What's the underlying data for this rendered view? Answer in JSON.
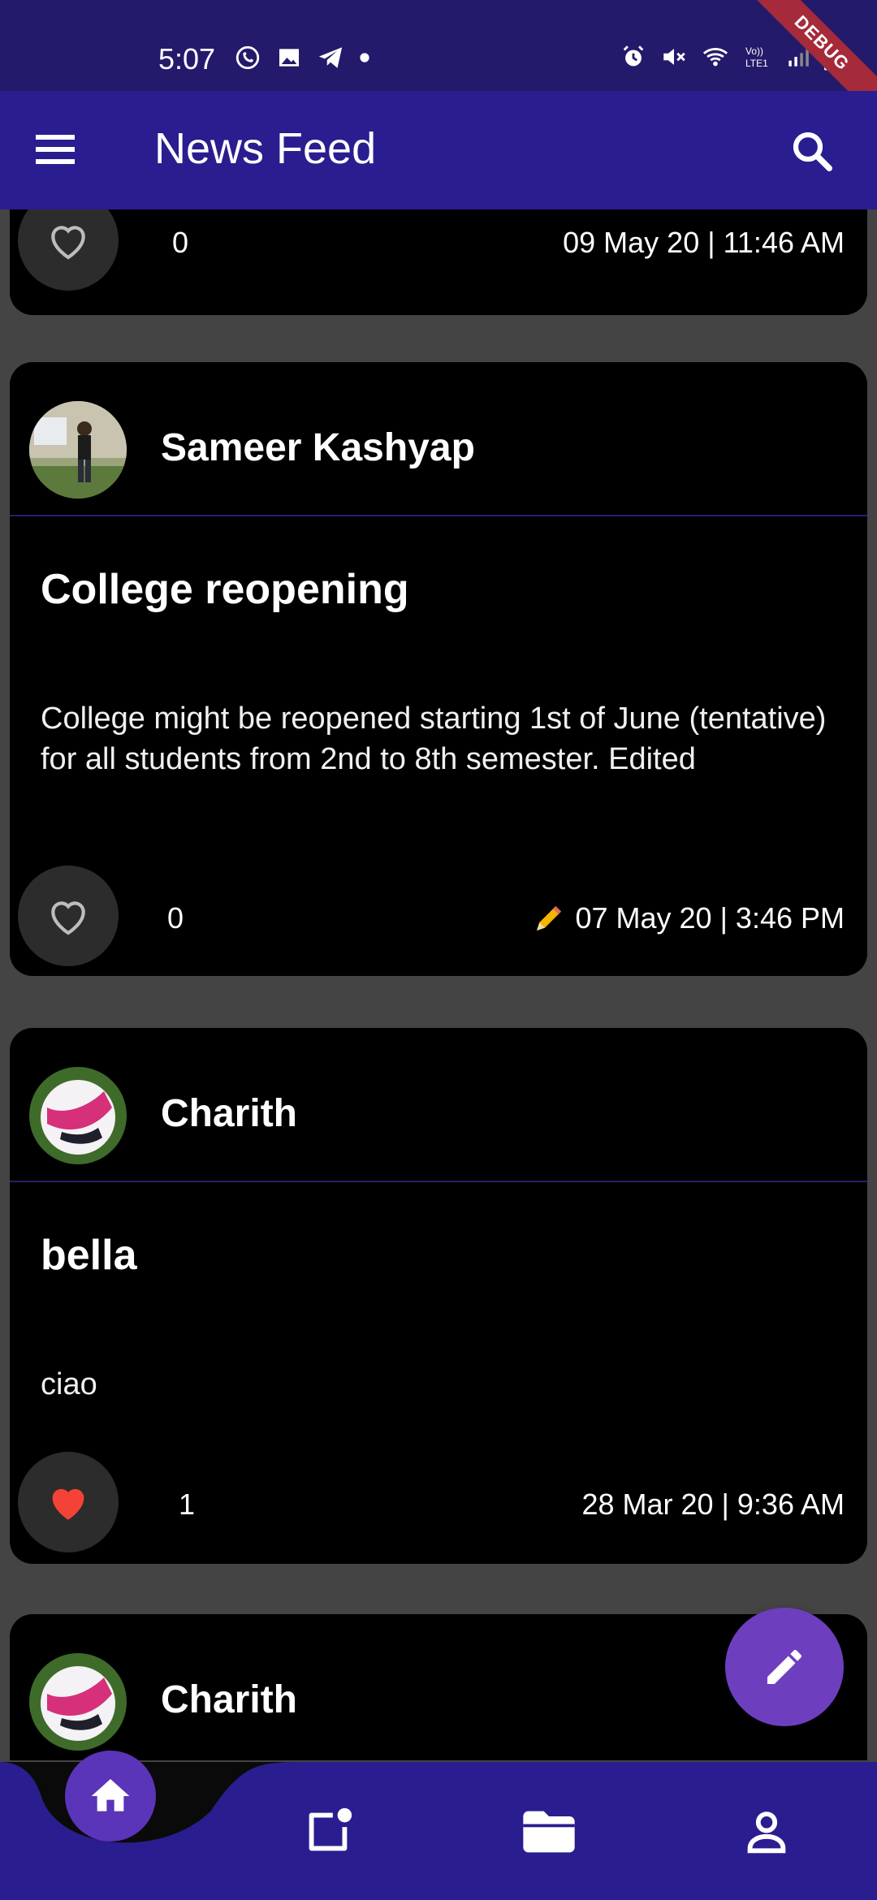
{
  "status_bar": {
    "time": "5:07",
    "debug_label": "DEBUG",
    "left_icons": [
      "whatsapp-icon",
      "gallery-icon",
      "telegram-icon",
      "dot-icon"
    ],
    "right_icons": [
      "alarm-icon",
      "mute-icon",
      "wifi-icon",
      "volte-lte-icon",
      "signal-icon",
      "battery-icon"
    ]
  },
  "app_bar": {
    "title": "News Feed",
    "menu_icon": "menu-icon",
    "search_icon": "search-icon"
  },
  "colors": {
    "app_bar": "#2a1d8f",
    "status_bar": "#241a6b",
    "card": "#000000",
    "background": "#444444",
    "fab": "#6d3fbf",
    "like_active": "#f44336"
  },
  "posts": [
    {
      "likes": "0",
      "timestamp": "09 May 20 | 11:46 AM",
      "liked": false
    },
    {
      "author": "Sameer Kashyap",
      "title": "College reopening",
      "body": "College might be reopened starting 1st of June (tentative) for all students from 2nd to 8th semester. Edited",
      "likes": "0",
      "timestamp": "07 May 20 | 3:46 PM",
      "edited": true,
      "liked": false
    },
    {
      "author": "Charith",
      "title": "bella",
      "body": "ciao",
      "likes": "1",
      "timestamp": "28 Mar 20 | 9:36 AM",
      "liked": true
    },
    {
      "author": "Charith"
    }
  ],
  "bottom_nav": {
    "items": [
      "home-icon",
      "notification-post-icon",
      "folder-icon",
      "profile-icon"
    ],
    "active": "home-icon"
  },
  "fab": {
    "icon": "edit-icon"
  }
}
